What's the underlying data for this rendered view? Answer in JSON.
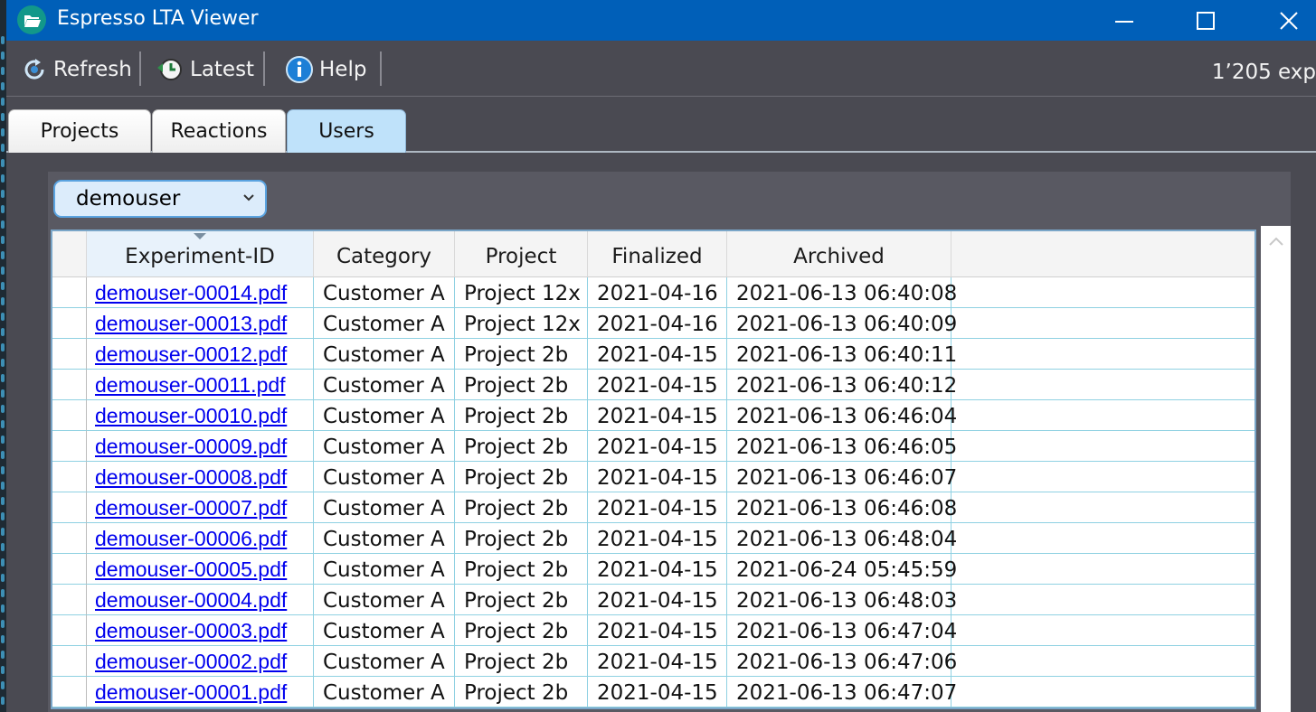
{
  "window": {
    "title": "Espresso LTA Viewer",
    "title_bg": "#005fb8",
    "icon": "folder-open-icon",
    "controls": [
      "minimize-icon",
      "maximize-icon",
      "close-icon"
    ]
  },
  "toolbar": {
    "refresh_label": "Refresh",
    "latest_label": "Latest",
    "help_label": "Help",
    "count_text": "1’205 exp"
  },
  "tabs": [
    {
      "label": "Projects",
      "active": false
    },
    {
      "label": "Reactions",
      "active": false
    },
    {
      "label": "Users",
      "active": true
    }
  ],
  "user_select": {
    "value": "demouser"
  },
  "table": {
    "sorted_column": "Experiment-ID",
    "columns": [
      "Experiment-ID",
      "Category",
      "Project",
      "Finalized",
      "Archived"
    ],
    "rows": [
      {
        "id": "demouser-00014.pdf",
        "category": "Customer A",
        "project": "Project 12x",
        "finalized": "2021-04-16",
        "archived": "2021-06-13 06:40:08"
      },
      {
        "id": "demouser-00013.pdf",
        "category": "Customer A",
        "project": "Project 12x",
        "finalized": "2021-04-16",
        "archived": "2021-06-13 06:40:09"
      },
      {
        "id": "demouser-00012.pdf",
        "category": "Customer A",
        "project": "Project 2b",
        "finalized": "2021-04-15",
        "archived": "2021-06-13 06:40:11"
      },
      {
        "id": "demouser-00011.pdf",
        "category": "Customer A",
        "project": "Project 2b",
        "finalized": "2021-04-15",
        "archived": "2021-06-13 06:40:12"
      },
      {
        "id": "demouser-00010.pdf",
        "category": "Customer A",
        "project": "Project 2b",
        "finalized": "2021-04-15",
        "archived": "2021-06-13 06:46:04"
      },
      {
        "id": "demouser-00009.pdf",
        "category": "Customer A",
        "project": "Project 2b",
        "finalized": "2021-04-15",
        "archived": "2021-06-13 06:46:05"
      },
      {
        "id": "demouser-00008.pdf",
        "category": "Customer A",
        "project": "Project 2b",
        "finalized": "2021-04-15",
        "archived": "2021-06-13 06:46:07"
      },
      {
        "id": "demouser-00007.pdf",
        "category": "Customer A",
        "project": "Project 2b",
        "finalized": "2021-04-15",
        "archived": "2021-06-13 06:46:08"
      },
      {
        "id": "demouser-00006.pdf",
        "category": "Customer A",
        "project": "Project 2b",
        "finalized": "2021-04-15",
        "archived": "2021-06-13 06:48:04"
      },
      {
        "id": "demouser-00005.pdf",
        "category": "Customer A",
        "project": "Project 2b",
        "finalized": "2021-04-15",
        "archived": "2021-06-24 05:45:59"
      },
      {
        "id": "demouser-00004.pdf",
        "category": "Customer A",
        "project": "Project 2b",
        "finalized": "2021-04-15",
        "archived": "2021-06-13 06:48:03"
      },
      {
        "id": "demouser-00003.pdf",
        "category": "Customer A",
        "project": "Project 2b",
        "finalized": "2021-04-15",
        "archived": "2021-06-13 06:47:04"
      },
      {
        "id": "demouser-00002.pdf",
        "category": "Customer A",
        "project": "Project 2b",
        "finalized": "2021-04-15",
        "archived": "2021-06-13 06:47:06"
      },
      {
        "id": "demouser-00001.pdf",
        "category": "Customer A",
        "project": "Project 2b",
        "finalized": "2021-04-15",
        "archived": "2021-06-13 06:47:07"
      }
    ]
  }
}
